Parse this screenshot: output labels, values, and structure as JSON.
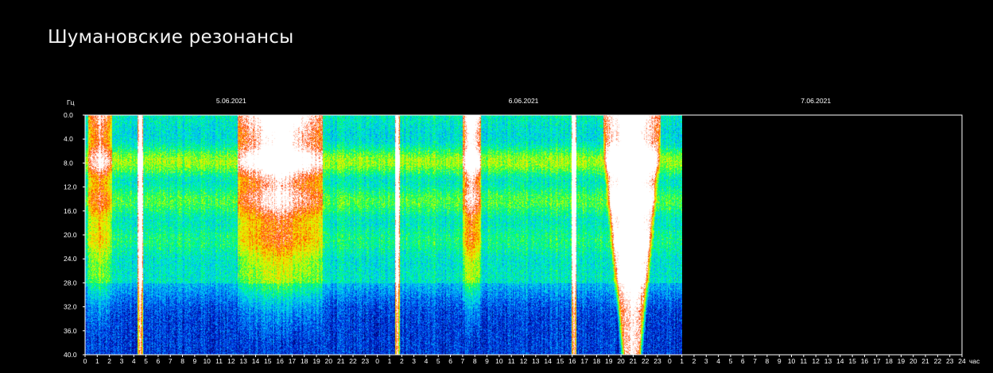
{
  "page": {
    "title": "Шумановские резонансы"
  },
  "chart_data": {
    "type": "heatmap",
    "title": "",
    "ylabel": "Гц",
    "xlabel": "час",
    "ylim": [
      0,
      40
    ],
    "y_ticks": [
      "0.0",
      "4.0",
      "8.0",
      "12.0",
      "16.0",
      "20.0",
      "24.0",
      "28.0",
      "32.0",
      "36.0",
      "40.0"
    ],
    "x_hour_ticks": [
      "0",
      "1",
      "2",
      "3",
      "4",
      "5",
      "6",
      "7",
      "8",
      "9",
      "10",
      "11",
      "12",
      "13",
      "14",
      "15",
      "16",
      "17",
      "18",
      "19",
      "20",
      "21",
      "22",
      "23",
      "0",
      "1",
      "2",
      "3",
      "4",
      "5",
      "6",
      "7",
      "8",
      "9",
      "10",
      "11",
      "12",
      "13",
      "14",
      "15",
      "16",
      "17",
      "18",
      "19",
      "20",
      "21",
      "22",
      "23",
      "0",
      "1",
      "2",
      "3",
      "4",
      "5",
      "6",
      "7",
      "8",
      "9",
      "10",
      "11",
      "12",
      "13",
      "14",
      "15",
      "16",
      "17",
      "18",
      "19",
      "20",
      "21",
      "22",
      "23",
      "24"
    ],
    "dates": [
      "5.06.2021",
      "6.06.2021",
      "7.06.2021"
    ],
    "x_range_hours": [
      0,
      72
    ],
    "data_end_hour": 49,
    "resonance_bands_hz": [
      7.8,
      14.3,
      20.8,
      27.3
    ],
    "intensity_bursts": [
      {
        "day": "5.06.2021",
        "from_hour": 0.2,
        "to_hour": 2.2,
        "level": "high"
      },
      {
        "day": "5.06.2021",
        "from_hour": 4.3,
        "to_hour": 4.7,
        "level": "saturated"
      },
      {
        "day": "5.06.2021",
        "from_hour": 12.5,
        "to_hour": 19.5,
        "level": "saturated"
      },
      {
        "day": "6.06.2021",
        "from_hour": 1.4,
        "to_hour": 1.8,
        "level": "saturated"
      },
      {
        "day": "6.06.2021",
        "from_hour": 7.0,
        "to_hour": 8.5,
        "level": "saturated"
      },
      {
        "day": "6.06.2021",
        "from_hour": 15.9,
        "to_hour": 16.3,
        "level": "saturated"
      },
      {
        "day": "6.06.2021",
        "from_hour": 18.5,
        "to_hour": 23.2,
        "level": "saturated"
      }
    ],
    "colors": {
      "background": "#000000",
      "axis": "#ffffff",
      "scale": [
        "#00008c",
        "#0040ff",
        "#00e0ff",
        "#00ff40",
        "#ffff00",
        "#ff0000",
        "#ffffff"
      ]
    }
  }
}
